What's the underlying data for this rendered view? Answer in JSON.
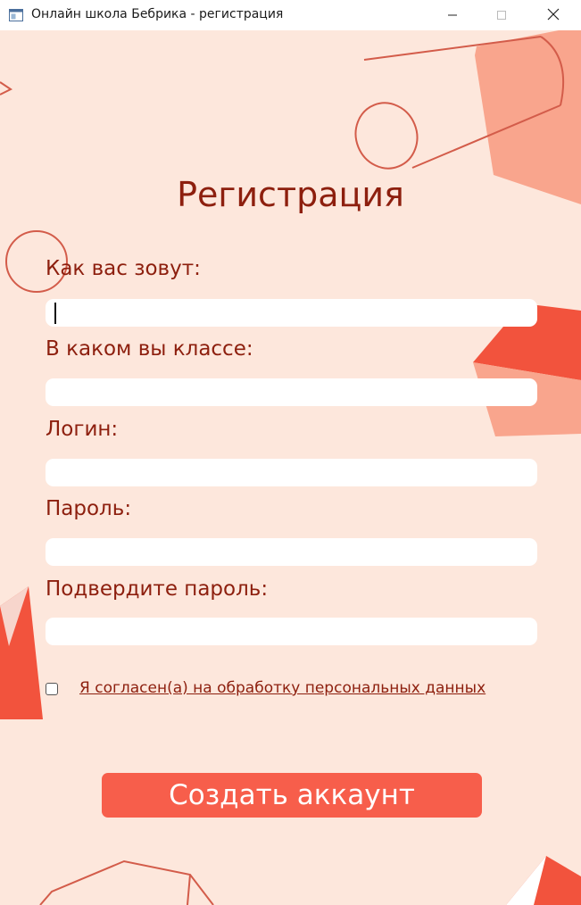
{
  "window": {
    "title": "Онлайн школа Бебрика - регистрация",
    "icons": [
      "app-icon",
      "minimize-icon",
      "maximize-icon",
      "close-icon"
    ]
  },
  "form": {
    "heading": "Регистрация",
    "fields": [
      {
        "label": "Как вас зовут:",
        "value": "",
        "focused": true
      },
      {
        "label": "В каком вы классе:",
        "value": ""
      },
      {
        "label": "Логин:",
        "value": ""
      },
      {
        "label": "Пароль:",
        "value": ""
      },
      {
        "label": "Подвердите пароль:",
        "value": ""
      }
    ],
    "consent": {
      "label": "Я согласен(а) на обработку персональных данных",
      "checked": false
    },
    "submit_label": "Создать аккаунт"
  },
  "colors": {
    "background": "#fde7dc",
    "text": "#8d1f0e",
    "accent": "#f75e4b",
    "decoration_light": "#f9a58d",
    "decoration_outline": "#d35c4a"
  }
}
